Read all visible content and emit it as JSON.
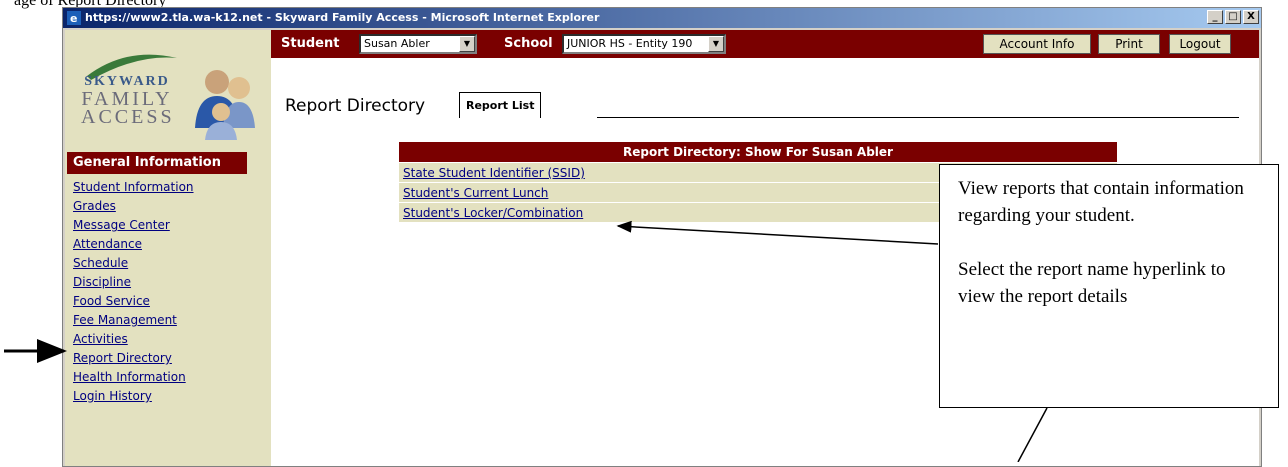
{
  "document": {
    "visible_text": "age of Report Directory"
  },
  "window": {
    "title": "https://www2.tla.wa-k12.net - Skyward Family Access - Microsoft Internet Explorer",
    "buttons": {
      "minimize": "_",
      "maximize": "□",
      "close": "X"
    }
  },
  "logo": {
    "line1": "SKYWARD",
    "line2": "FAMILY",
    "line3": "ACCESS"
  },
  "topbar": {
    "student_label": "Student",
    "student_value": "Susan Abler",
    "school_label": "School",
    "school_value": "JUNIOR HS - Entity 190",
    "account_info": "Account Info",
    "print": "Print",
    "logout": "Logout"
  },
  "sidebar": {
    "header": "General Information",
    "items": [
      "Student Information",
      "Grades",
      "Message Center",
      "Attendance",
      "Schedule",
      "Discipline",
      "Food Service",
      "Fee Management",
      "Activities",
      "Report Directory",
      "Health Information",
      "Login History"
    ]
  },
  "main": {
    "title": "Report Directory",
    "tab": "Report List",
    "table_header": "Report Directory: Show For Susan Abler",
    "reports": [
      "State Student Identifier (SSID)",
      "Student's Current Lunch",
      "Student's Locker/Combination"
    ]
  },
  "callout": {
    "paragraph1": "View reports that contain information regarding your student.",
    "paragraph2": "Select the report name hyperlink to view the report details"
  },
  "colors": {
    "maroon": "#7a0000",
    "tan": "#e3e1c0",
    "link": "#000080"
  }
}
